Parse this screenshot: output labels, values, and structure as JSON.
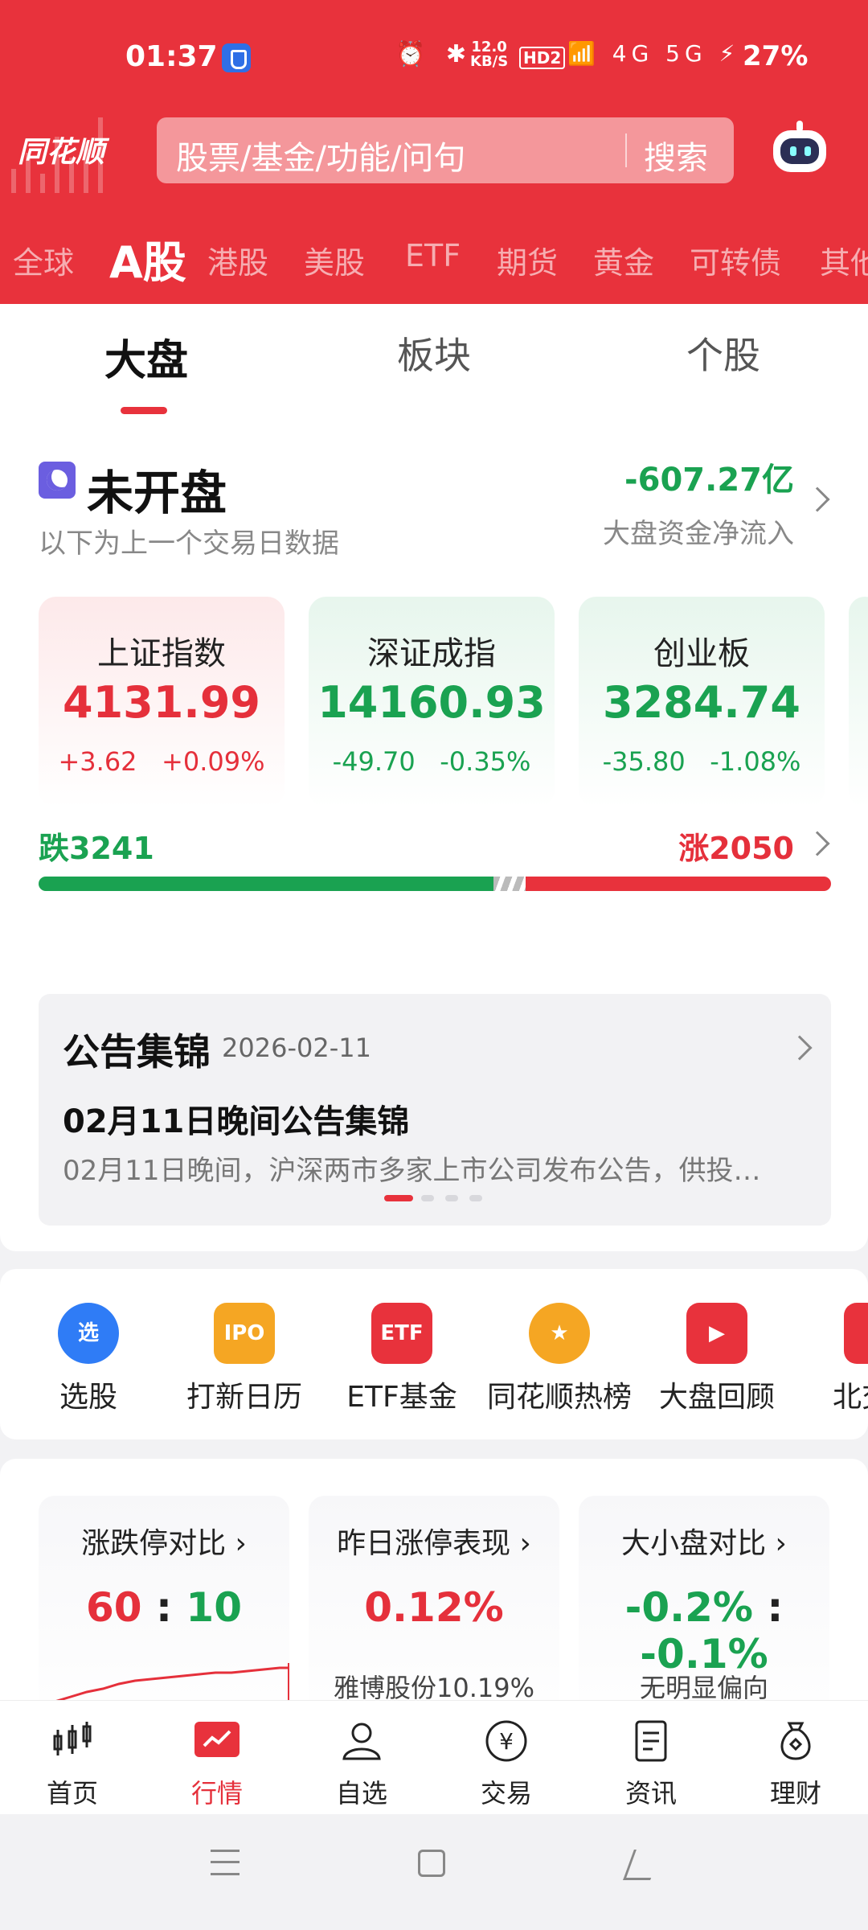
{
  "status_bar": {
    "time": "01:37",
    "icons": "⏰ ✱",
    "speed_top": "12.0",
    "speed_unit": "KB/S",
    "hd": "HD2",
    "signal": "📶 4G 5G ⚡",
    "battery": "27%"
  },
  "header": {
    "logo": "同花顺",
    "search_placeholder": "股票/基金/功能/问句",
    "search_button": "搜索",
    "avatar_icon": "robot-icon"
  },
  "market_tabs": [
    "全球",
    "A股",
    "港股",
    "美股",
    "ETF",
    "期货",
    "黄金",
    "可转债",
    "其他"
  ],
  "sub_tabs": [
    "大盘",
    "板块",
    "个股"
  ],
  "market": {
    "status": "未开盘",
    "status_sub": "以下为上一个交易日数据",
    "net_flow": "-607.27亿",
    "net_flow_label": "大盘资金净流入"
  },
  "indices": [
    {
      "name": "上证指数",
      "value": "4131.99",
      "change": "+3.62",
      "pct": "+0.09%",
      "trend": "up"
    },
    {
      "name": "深证成指",
      "value": "14160.93",
      "change": "-49.70",
      "pct": "-0.35%",
      "trend": "down"
    },
    {
      "name": "创业板",
      "value": "3284.74",
      "change": "-35.80",
      "pct": "-1.08%",
      "trend": "down"
    }
  ],
  "breadth": {
    "fall": "跌3241",
    "rise": "涨2050",
    "fall_count": 3241,
    "rise_count": 2050
  },
  "notice": {
    "title": "公告集锦",
    "date": "2026-02-11",
    "headline": "02月11日晚间公告集锦",
    "desc": "02月11日晚间，沪深两市多家上市公司发布公告，供投…"
  },
  "tools": [
    {
      "label": "选股",
      "icon": "选",
      "color": "#2f7cf6"
    },
    {
      "label": "打新日历",
      "icon": "IPO",
      "color": "#f5a623"
    },
    {
      "label": "ETF基金",
      "icon": "ETF",
      "color": "#e8323c"
    },
    {
      "label": "同花顺热榜",
      "icon": "★",
      "color": "#f5a623"
    },
    {
      "label": "大盘回顾",
      "icon": "▶",
      "color": "#e8323c"
    },
    {
      "label": "北交",
      "icon": "",
      "color": "#e8323c"
    }
  ],
  "stats": [
    {
      "title": "涨跌停对比 ›",
      "value_a": "60",
      "sep": ":",
      "value_b": "10",
      "extra": ""
    },
    {
      "title": "昨日涨停表现 ›",
      "value": "0.12%",
      "extra": "雅博股份10.19%"
    },
    {
      "title": "大小盘对比 ›",
      "value_a": "-0.2%",
      "sep": ":",
      "value_b": "-0.1%",
      "extra": "无明显偏向"
    }
  ],
  "bottom_nav": [
    "首页",
    "行情",
    "自选",
    "交易",
    "资讯",
    "理财"
  ],
  "colors": {
    "brand": "#e8323c",
    "up": "#e5303b",
    "down": "#1aa251"
  }
}
